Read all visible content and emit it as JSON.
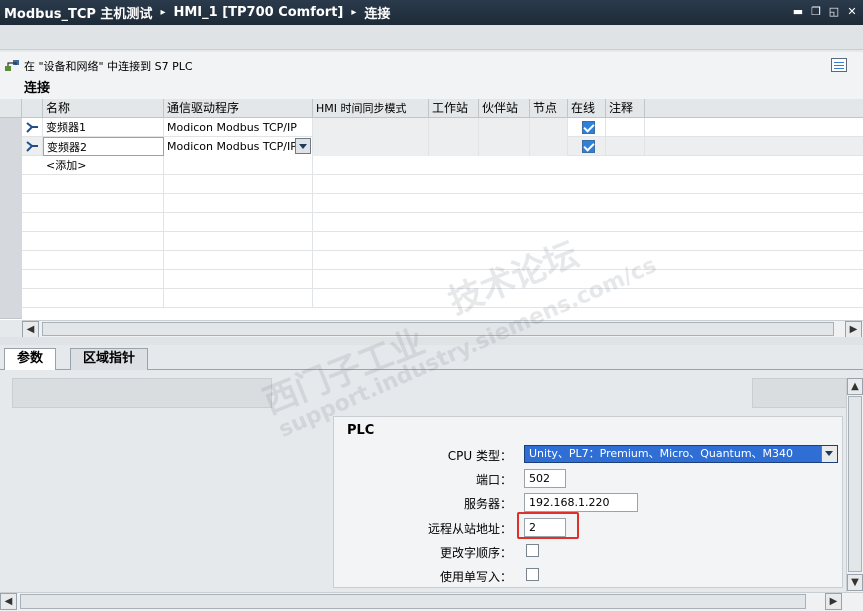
{
  "titlebar": {
    "crumb1": "Modbus_TCP 主机测试",
    "crumb2": "HMI_1 [TP700 Comfort]",
    "crumb3": "连接",
    "sep": "▸"
  },
  "infobar": {
    "text": "在 \"设备和网络\" 中连接到 S7 PLC"
  },
  "section": {
    "title": "连接"
  },
  "grid": {
    "columns": [
      "名称",
      "通信驱动程序",
      "HMI 时间同步模式",
      "工作站",
      "伙伴站",
      "节点",
      "在线",
      "注释"
    ],
    "rows": [
      {
        "name": "变频器1",
        "driver": "Modicon Modbus TCP/IP",
        "online": true
      },
      {
        "name": "变频器2",
        "driver": "Modicon Modbus TCP/IP",
        "online": true
      }
    ],
    "add_label": "<添加>"
  },
  "tabs": [
    {
      "label": "参数",
      "active": true
    },
    {
      "label": "区域指针",
      "active": false
    }
  ],
  "plc": {
    "title": "PLC",
    "cpu_type_label": "CPU 类型：",
    "cpu_type_value": "Unity、PL7：Premium、Micro、Quantum、M340",
    "port_label": "端口：",
    "port_value": "502",
    "server_label": "服务器：",
    "server_value": "192.168.1.220",
    "remote_label": "远程从站地址：",
    "remote_value": "2",
    "byte_order_label": "更改字顺序：",
    "single_write_label": "使用单写入："
  },
  "watermark": {
    "line1": "西门子工业",
    "line2": "技术论坛",
    "line3": "support.industry.siemens.com/cs"
  },
  "colors": {
    "titlebar": "#1d2a37",
    "accent_blue": "#2f6fd5",
    "highlight_red": "#e0302a"
  }
}
